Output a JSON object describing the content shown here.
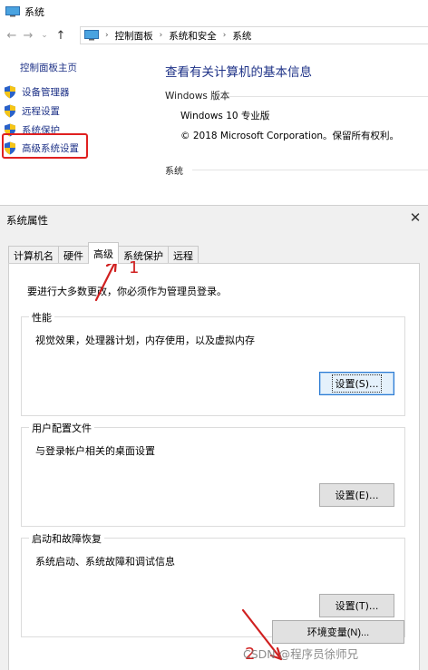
{
  "system_window": {
    "title": "系统",
    "breadcrumb": [
      "控制面板",
      "系统和安全",
      "系统"
    ],
    "left_links": {
      "home": "控制面板主页",
      "items": [
        "设备管理器",
        "远程设置",
        "系统保护",
        "高级系统设置"
      ]
    },
    "main": {
      "title": "查看有关计算机的基本信息",
      "edition_header": "Windows 版本",
      "edition": "Windows 10 专业版",
      "copyright": "© 2018 Microsoft Corporation。保留所有权利。",
      "system_header": "系统"
    }
  },
  "dialog": {
    "title": "系统属性",
    "close_glyph": "✕",
    "tabs": [
      "计算机名",
      "硬件",
      "高级",
      "系统保护",
      "远程"
    ],
    "active_tab": "高级",
    "admin_note": "要进行大多数更改，你必须作为管理员登录。",
    "performance": {
      "label": "性能",
      "desc": "视觉效果，处理器计划，内存使用，以及虚拟内存",
      "button": "设置(S)..."
    },
    "user_profiles": {
      "label": "用户配置文件",
      "desc": "与登录帐户相关的桌面设置",
      "button": "设置(E)..."
    },
    "startup_recovery": {
      "label": "启动和故障恢复",
      "desc": "系统启动、系统故障和调试信息",
      "button": "设置(T)..."
    },
    "env_button": "环境变量(N)..."
  },
  "annotations": {
    "step1": "1",
    "step2": "2",
    "color": "#d02020"
  },
  "watermark": "CSDN @程序员徐师兄"
}
